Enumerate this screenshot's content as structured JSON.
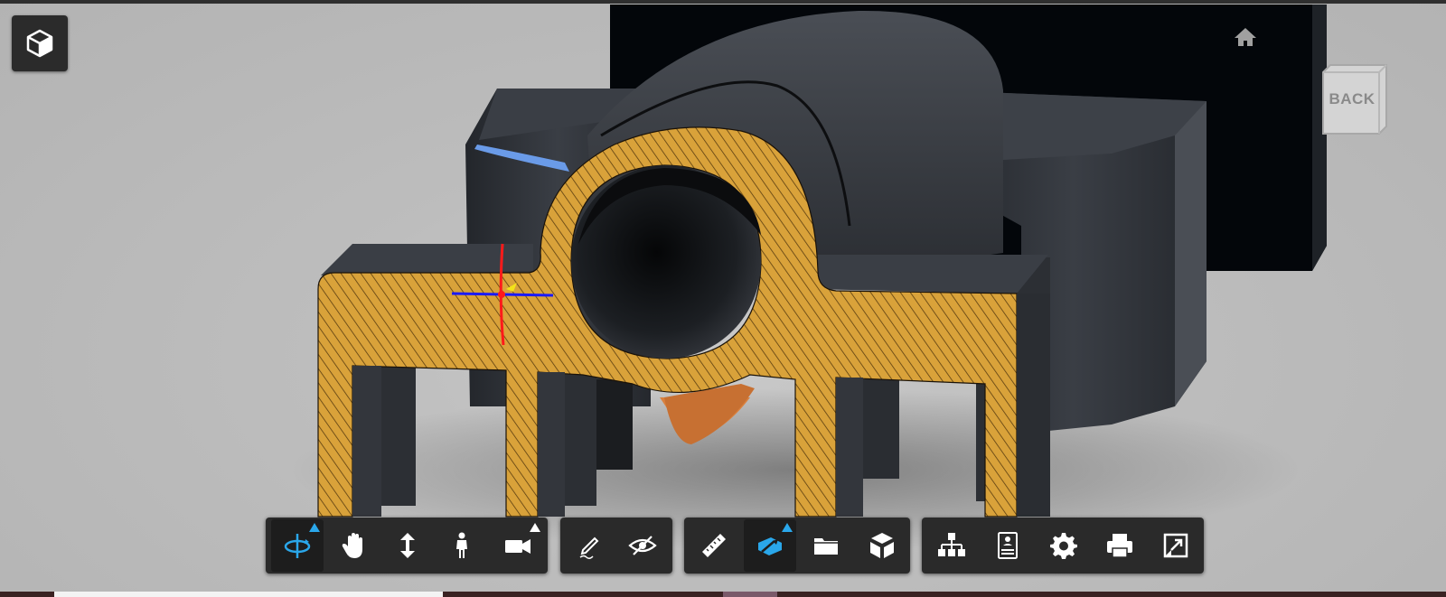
{
  "viewer": {
    "back_label": "BACK",
    "colors": {
      "background": "#bdbdbd",
      "toolbar": "#2a2a2a",
      "active_icon": "#2aa7ea",
      "section_fill": "#d9a23a",
      "part_dark": "#2e3136",
      "axis_x": "#1a1aff",
      "axis_y": "#ff1a1a"
    },
    "icons": {
      "view_cube": "box-icon",
      "home": "home-icon"
    }
  },
  "toolbar": {
    "groups": [
      {
        "name": "navigation",
        "buttons": [
          {
            "name": "orbit",
            "icon": "orbit-icon",
            "active": true,
            "flyout": true
          },
          {
            "name": "pan",
            "icon": "hand-icon"
          },
          {
            "name": "zoom",
            "icon": "zoom-arrows-icon"
          },
          {
            "name": "first-person",
            "icon": "person-icon"
          },
          {
            "name": "camera",
            "icon": "camera-icon",
            "flyout": true
          }
        ]
      },
      {
        "name": "markup",
        "buttons": [
          {
            "name": "markup",
            "icon": "pencil-icon"
          },
          {
            "name": "visibility",
            "icon": "eye-slash-icon"
          }
        ]
      },
      {
        "name": "analysis",
        "buttons": [
          {
            "name": "measure",
            "icon": "ruler-icon"
          },
          {
            "name": "section",
            "icon": "section-plane-icon",
            "active": true,
            "flyout": true
          },
          {
            "name": "explode",
            "icon": "folder-icon"
          },
          {
            "name": "model",
            "icon": "cube-parts-icon"
          }
        ]
      },
      {
        "name": "settings",
        "buttons": [
          {
            "name": "model-browser",
            "icon": "tree-icon"
          },
          {
            "name": "properties",
            "icon": "properties-icon"
          },
          {
            "name": "settings",
            "icon": "gear-icon"
          },
          {
            "name": "print",
            "icon": "printer-icon"
          },
          {
            "name": "fullscreen",
            "icon": "fullscreen-icon"
          }
        ]
      }
    ]
  }
}
